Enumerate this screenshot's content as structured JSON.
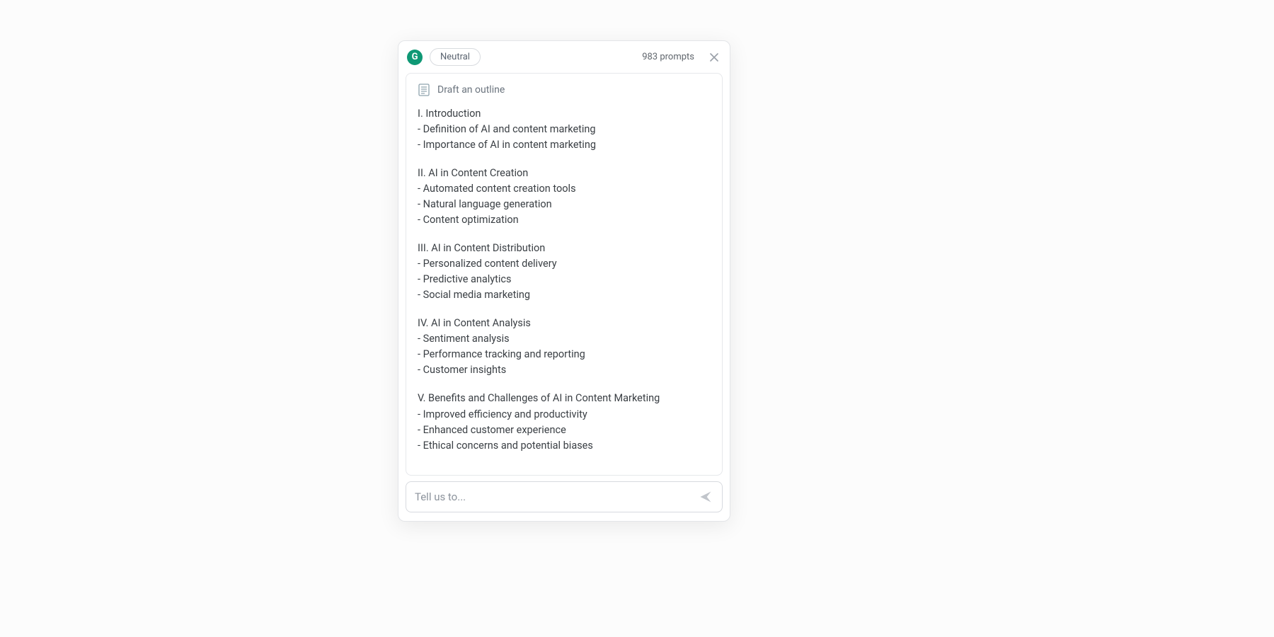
{
  "header": {
    "logo_letter": "G",
    "tone_label": "Neutral",
    "prompts_label": "983 prompts"
  },
  "draft": {
    "heading": "Draft an outline",
    "sections": [
      {
        "title": "I. Introduction",
        "bullets": [
          "- Definition of AI and content marketing",
          "- Importance of AI in content marketing"
        ]
      },
      {
        "title": "II. AI in Content Creation",
        "bullets": [
          "- Automated content creation tools",
          "- Natural language generation",
          "- Content optimization"
        ]
      },
      {
        "title": "III. AI in Content Distribution",
        "bullets": [
          "- Personalized content delivery",
          "- Predictive analytics",
          "- Social media marketing"
        ]
      },
      {
        "title": "IV. AI in Content Analysis",
        "bullets": [
          "- Sentiment analysis",
          "- Performance tracking and reporting",
          "- Customer insights"
        ]
      },
      {
        "title": "V. Benefits and Challenges of AI in Content Marketing",
        "bullets": [
          "- Improved efficiency and productivity",
          "- Enhanced customer experience",
          "- Ethical concerns and potential biases"
        ]
      }
    ]
  },
  "input": {
    "placeholder": "Tell us to..."
  }
}
